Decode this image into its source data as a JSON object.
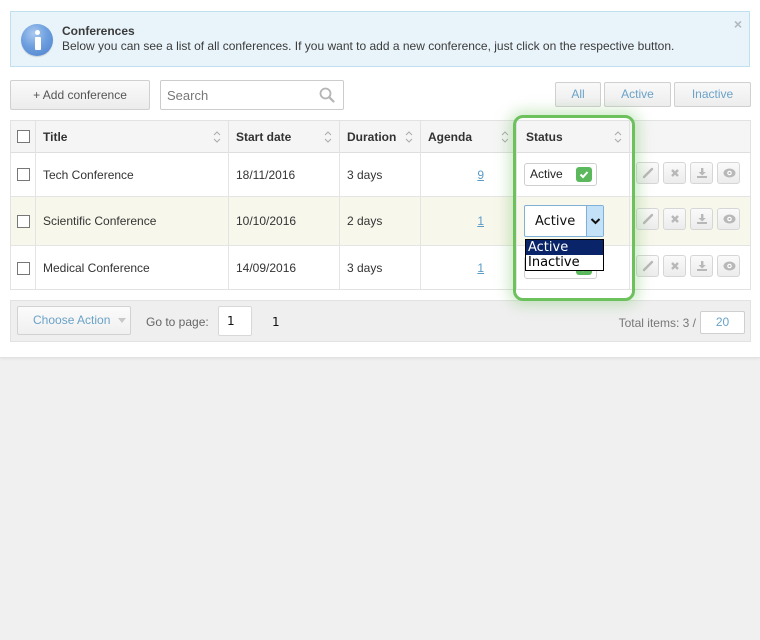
{
  "alert": {
    "icon": "info-icon",
    "title": "Conferences",
    "description": "Below you can see a list of all conferences. If you want to add a new conference, just click on the respective button.",
    "close_glyph": "×"
  },
  "toolbar": {
    "add_label": "+ Add conference",
    "search_placeholder": "Search",
    "search_value": "",
    "filters": [
      "All",
      "Active",
      "Inactive"
    ]
  },
  "table": {
    "columns": [
      "Title",
      "Start date",
      "Duration",
      "Agenda",
      "Status"
    ],
    "rows": [
      {
        "title": "Tech Conference",
        "start_date": "18/11/2016",
        "duration": "3 days",
        "agenda": "9",
        "status": "Active",
        "status_checked": true,
        "highlight": false
      },
      {
        "title": "Scientific Conference",
        "start_date": "10/10/2016",
        "duration": "2 days",
        "agenda": "1",
        "status": "Active",
        "status_checked": true,
        "highlight": true
      },
      {
        "title": "Medical Conference",
        "start_date": "14/09/2016",
        "duration": "3 days",
        "agenda": "1",
        "status": "Active",
        "status_checked": true,
        "highlight": false
      }
    ],
    "row_actions": [
      "pencil-icon",
      "close-icon",
      "download-icon",
      "eye-icon"
    ]
  },
  "status_dropdown": {
    "selected": "Active",
    "options": [
      "Active",
      "Inactive"
    ],
    "highlighted_option": "Active"
  },
  "footer": {
    "choose_action_label": "Choose Action",
    "goto_label": "Go to page:",
    "goto_value": "1",
    "page_count": "1",
    "total_label": "Total items: 3 /",
    "per_page": "20"
  },
  "colors": {
    "accent_blue": "#6aa2c8",
    "highlight_green": "#6cc15d",
    "check_green": "#5cb85c",
    "selected_option_bg": "#0a246a",
    "alert_bg": "#e8f4fa",
    "row_highlight_bg": "#f8f7ec"
  }
}
